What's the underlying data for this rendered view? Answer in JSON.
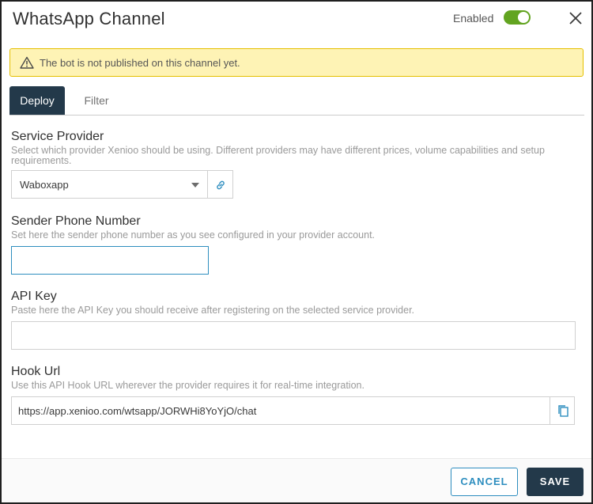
{
  "header": {
    "title": "WhatsApp Channel",
    "enabled_label": "Enabled",
    "enabled": true
  },
  "alert": {
    "text": "The bot is not published on this channel yet.",
    "icon": "warning-icon"
  },
  "tabs": [
    {
      "label": "Deploy",
      "active": true
    },
    {
      "label": "Filter",
      "active": false
    }
  ],
  "service_provider": {
    "label": "Service Provider",
    "help": "Select which provider Xenioo should be using. Different providers may have different prices, volume capabilities and setup requirements.",
    "selected": "Waboxapp"
  },
  "sender_phone": {
    "label": "Sender Phone Number",
    "help": "Set here the sender phone number as you see configured in your provider account.",
    "value": ""
  },
  "api_key": {
    "label": "API Key",
    "help": "Paste here the API Key you should receive after registering on the selected service provider.",
    "value": ""
  },
  "hook_url": {
    "label": "Hook Url",
    "help": "Use this API Hook URL wherever the provider requires it for real-time integration.",
    "value": "https://app.xenioo.com/wtsapp/JORWHi8YoYjO/chat"
  },
  "footer": {
    "cancel_label": "CANCEL",
    "save_label": "SAVE"
  },
  "colors": {
    "primary_dark": "#23394a",
    "accent_blue": "#2e8ebf",
    "toggle_green": "#62a420",
    "alert_bg": "#fef3b5",
    "alert_border": "#e5c000"
  }
}
